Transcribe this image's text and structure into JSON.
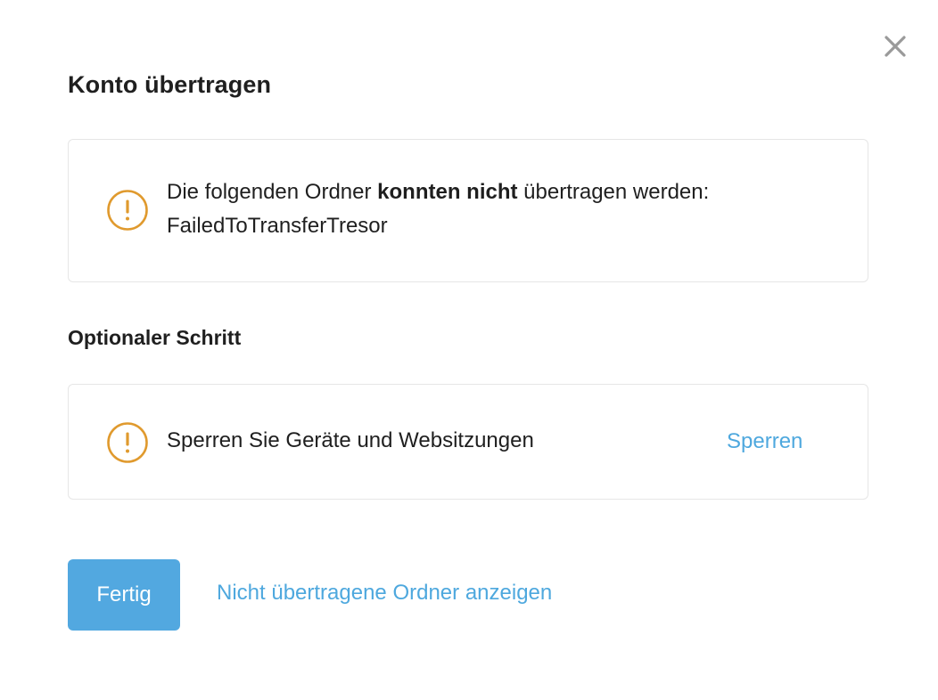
{
  "dialog": {
    "title": "Konto übertragen",
    "close_icon": "close-icon"
  },
  "error_card": {
    "icon": "warning-icon",
    "text_before": "Die folgenden Ordner ",
    "text_bold": "konnten nicht",
    "text_after": " übertragen werden:",
    "folder_name": "FailedToTransferTresor"
  },
  "optional_section": {
    "heading": "Optionaler Schritt",
    "icon": "warning-icon",
    "text": "Sperren Sie Geräte und Websitzungen",
    "action_label": "Sperren"
  },
  "footer": {
    "done_label": "Fertig",
    "show_link_label": "Nicht übertragene Ordner anzeigen"
  },
  "colors": {
    "warning": "#e09a2e",
    "link": "#4ea8de",
    "primary_button": "#52a8e0",
    "close_icon": "#9a9a9a"
  }
}
